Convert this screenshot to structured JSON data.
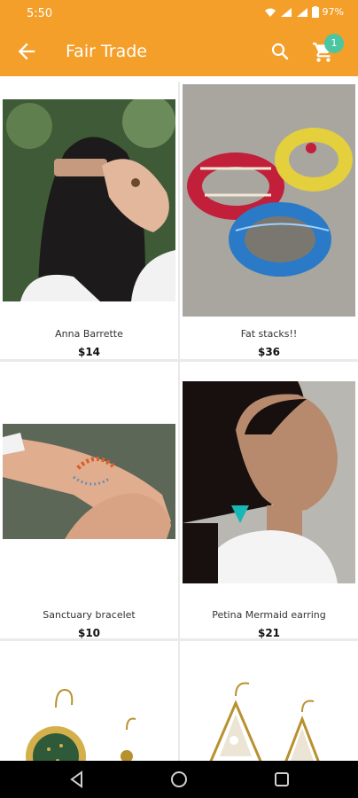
{
  "status_bar": {
    "time": "5:50",
    "battery": "97%"
  },
  "app_bar": {
    "title": "Fair Trade",
    "cart_count": "1",
    "icons": [
      "back-arrow-icon",
      "search-icon",
      "cart-icon"
    ]
  },
  "products": [
    {
      "name": "Anna Barrette",
      "price": "$14",
      "image": "woman-with-hair-barrette"
    },
    {
      "name": "Fat stacks!!",
      "price": "$36",
      "image": "painted-bangle-bracelets"
    },
    {
      "name": "Sanctuary bracelet",
      "price": "$10",
      "image": "beaded-wrist-bracelet"
    },
    {
      "name": "Petina Mermaid earring",
      "price": "$21",
      "image": "woman-with-turquoise-earring"
    },
    {
      "name": "",
      "price": "",
      "image": "round-gold-earrings"
    },
    {
      "name": "",
      "price": "",
      "image": "triangle-earrings"
    }
  ],
  "colors": {
    "primary": "#F49F2A",
    "badge": "#4BC6A1"
  }
}
